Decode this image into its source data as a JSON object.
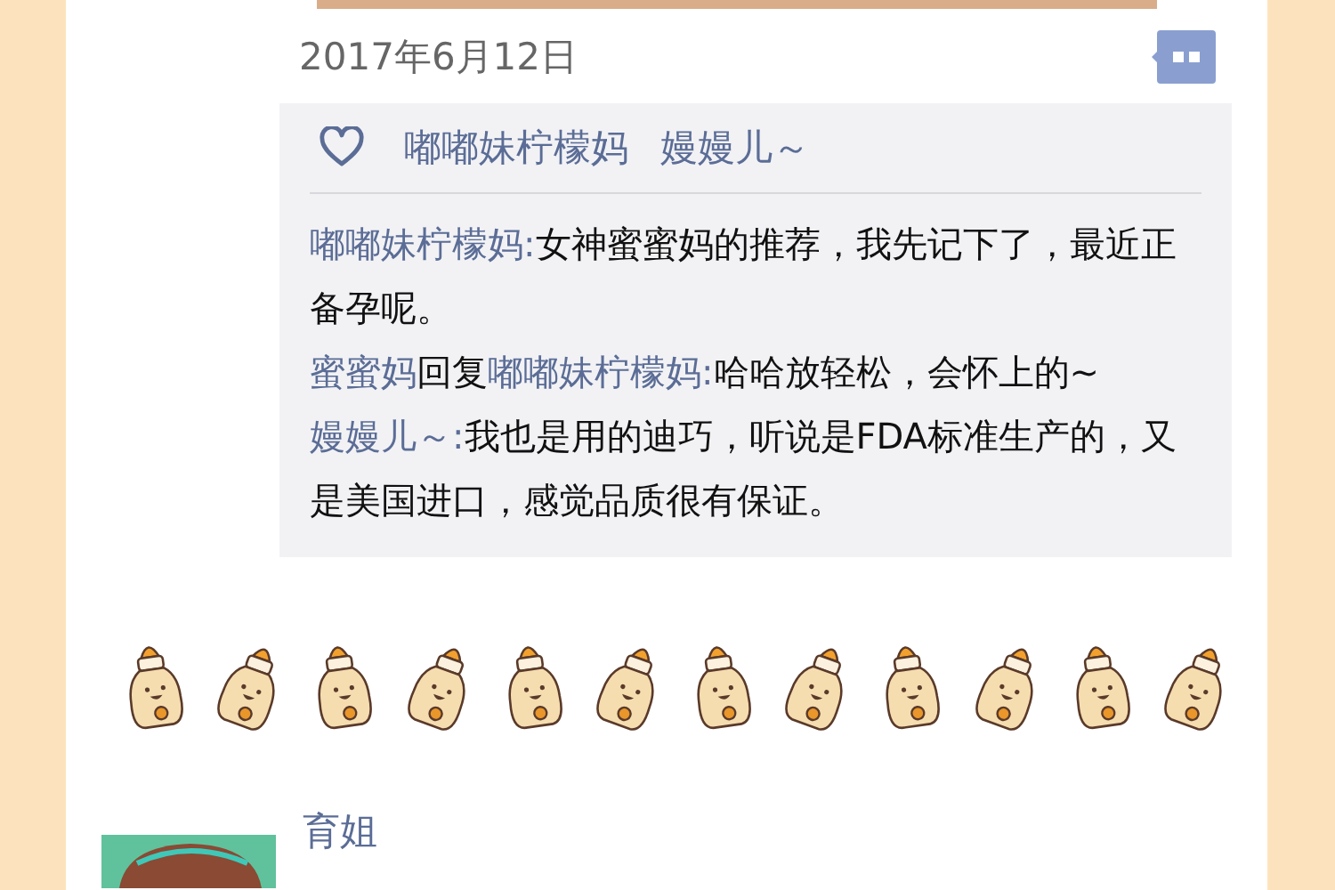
{
  "post": {
    "date": "2017年6月12日"
  },
  "likes": [
    "嘟嘟妹柠檬妈",
    "嫚嫚儿～"
  ],
  "comments": [
    {
      "author": "嘟嘟妹柠檬妈",
      "separator": ":",
      "text": "女神蜜蜜妈的推荐，我先记下了，最近正备孕呢。"
    },
    {
      "author": "蜜蜜妈",
      "reply_word": "回复",
      "reply_to": "嘟嘟妹柠檬妈",
      "separator": ":",
      "text": "哈哈放轻松，会怀上的~"
    },
    {
      "author": "嫚嫚儿～",
      "separator": ":",
      "text": "我也是用的迪巧，听说是FDA标准生产的，又是美国进口，感觉品质很有保证。"
    }
  ],
  "next_post": {
    "author": "育姐"
  }
}
